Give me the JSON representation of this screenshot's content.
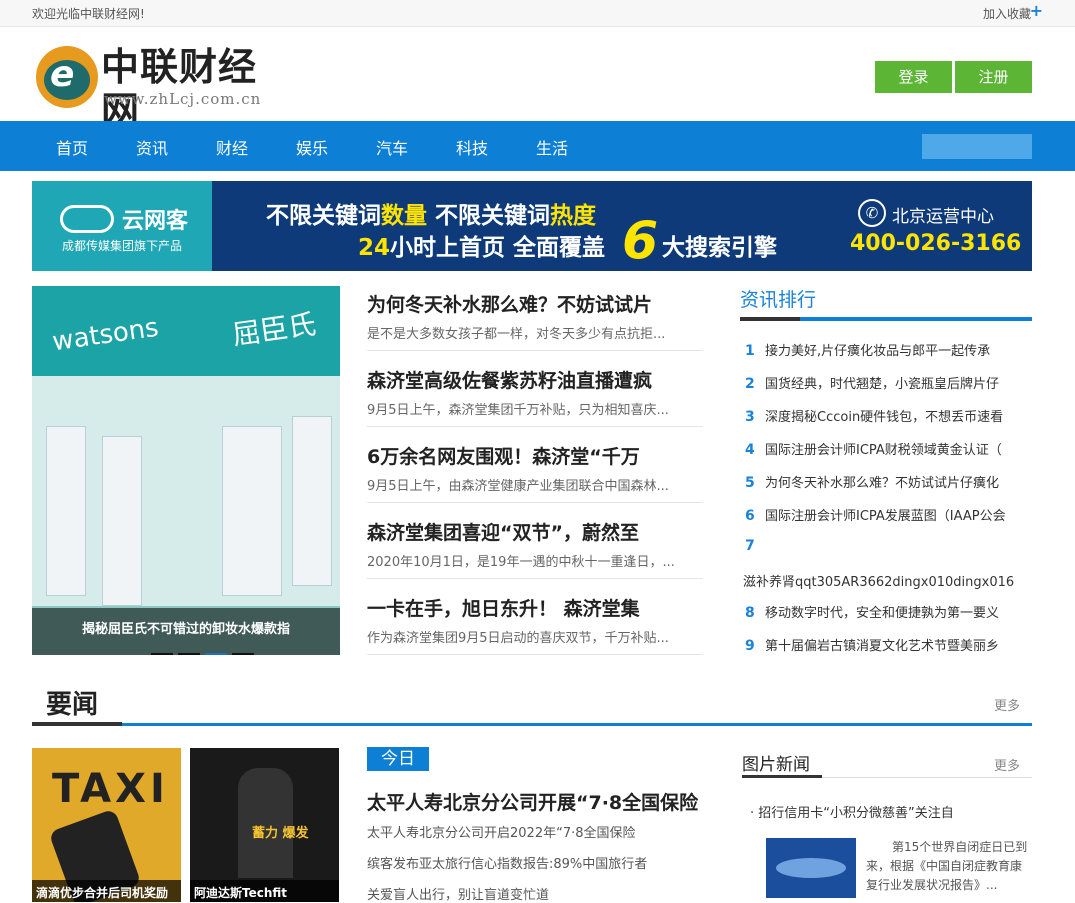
{
  "topbar": {
    "welcome": "欢迎光临中联财经网!",
    "favorite": "加入收藏",
    "plus": "+"
  },
  "logo": {
    "name": "中联财经网",
    "url": "www.zhLcj.com.cn",
    "mark": "e"
  },
  "auth": {
    "login": "登录",
    "register": "注册"
  },
  "nav": {
    "items": [
      "首页",
      "资讯",
      "财经",
      "娱乐",
      "汽车",
      "科技",
      "生活"
    ],
    "search_placeholder": ""
  },
  "banner": {
    "brand": "云网客",
    "brand_sub": "成都传媒集团旗下产品",
    "line1a": "不限关键词",
    "line1b": "数量",
    "line1c": " 不限关键词",
    "line1d": "热度",
    "line2a": "24",
    "line2b": "小时上首页  全面覆盖",
    "big": "6",
    "line2c": "大搜索引擎",
    "center": "北京运营中心",
    "phone": "400-026-3166",
    "phone_icon": "✆"
  },
  "slider": {
    "sign_en": "watsons",
    "sign_cn": "屈臣氏",
    "caption": "揭秘屈臣氏不可错过的卸妆水爆款指"
  },
  "news": [
    {
      "title": "为何冬天补水那么难？不妨试试片",
      "desc": "是不是大多数女孩子都一样，对冬天多少有点抗拒..."
    },
    {
      "title": "森济堂高级佐餐紫苏籽油直播遭疯",
      "desc": "9月5日上午，森济堂集团千万补贴，只为相知喜庆..."
    },
    {
      "title": "6万余名网友围观！森济堂“千万",
      "desc": "9月5日上午，由森济堂健康产业集团联合中国森林..."
    },
    {
      "title": "森济堂集团喜迎“双节”，蔚然至",
      "desc": "2020年10月1日，是19年一遇的中秋十一重逢日，..."
    },
    {
      "title": "一卡在手，旭日东升！ 森济堂集",
      "desc": "作为森济堂集团9月5日启动的喜庆双节，千万补贴..."
    }
  ],
  "ranking": {
    "title": "资讯排行",
    "items": [
      {
        "n": "1",
        "text": "接力美好,片仔癀化妆品与郎平一起传承"
      },
      {
        "n": "2",
        "text": "国货经典，时代翘楚，小瓷瓶皇后牌片仔"
      },
      {
        "n": "3",
        "text": "深度揭秘Cccoin硬件钱包，不想丢币速看"
      },
      {
        "n": "4",
        "text": "国际注册会计师ICPA财税领域黄金认证（"
      },
      {
        "n": "5",
        "text": "为何冬天补水那么难？不妨试试片仔癀化"
      },
      {
        "n": "6",
        "text": "国际注册会计师ICPA发展蓝图（IAAP公会"
      },
      {
        "n": "7",
        "text": ""
      },
      {
        "n": "",
        "text": "滋补养肾qqt305AR3662dingx010dingx016"
      },
      {
        "n": "8",
        "text": "移动数字时代，安全和便捷孰为第一要义"
      },
      {
        "n": "9",
        "text": "第十届偏岩古镇消夏文化艺术节暨美丽乡"
      }
    ]
  },
  "yaowen": {
    "title": "要闻",
    "more": "更多"
  },
  "pics": [
    {
      "caption": "滴滴优步合并后司机奖励",
      "sign": "TAXI"
    },
    {
      "caption": "阿迪达斯Techfit",
      "sign": "蓄力 爆发"
    }
  ],
  "today": {
    "badge": "今日",
    "headline": "太平人寿北京分公司开展“7·8全国保险",
    "lines": [
      "太平人寿北京分公司开启2022年“7·8全国保险",
      "缤客发布亚太旅行信心指数报告:89%中国旅行者",
      "关爱盲人出行，别让盲道变忙道"
    ]
  },
  "photo_news": {
    "title": "图片新闻",
    "more": "更多",
    "item": "招行信用卡“小积分微慈善”关注自",
    "text": "第15个世界自闭症日已到来，根据《中国自闭症教育康复行业发展状况报告》..."
  }
}
